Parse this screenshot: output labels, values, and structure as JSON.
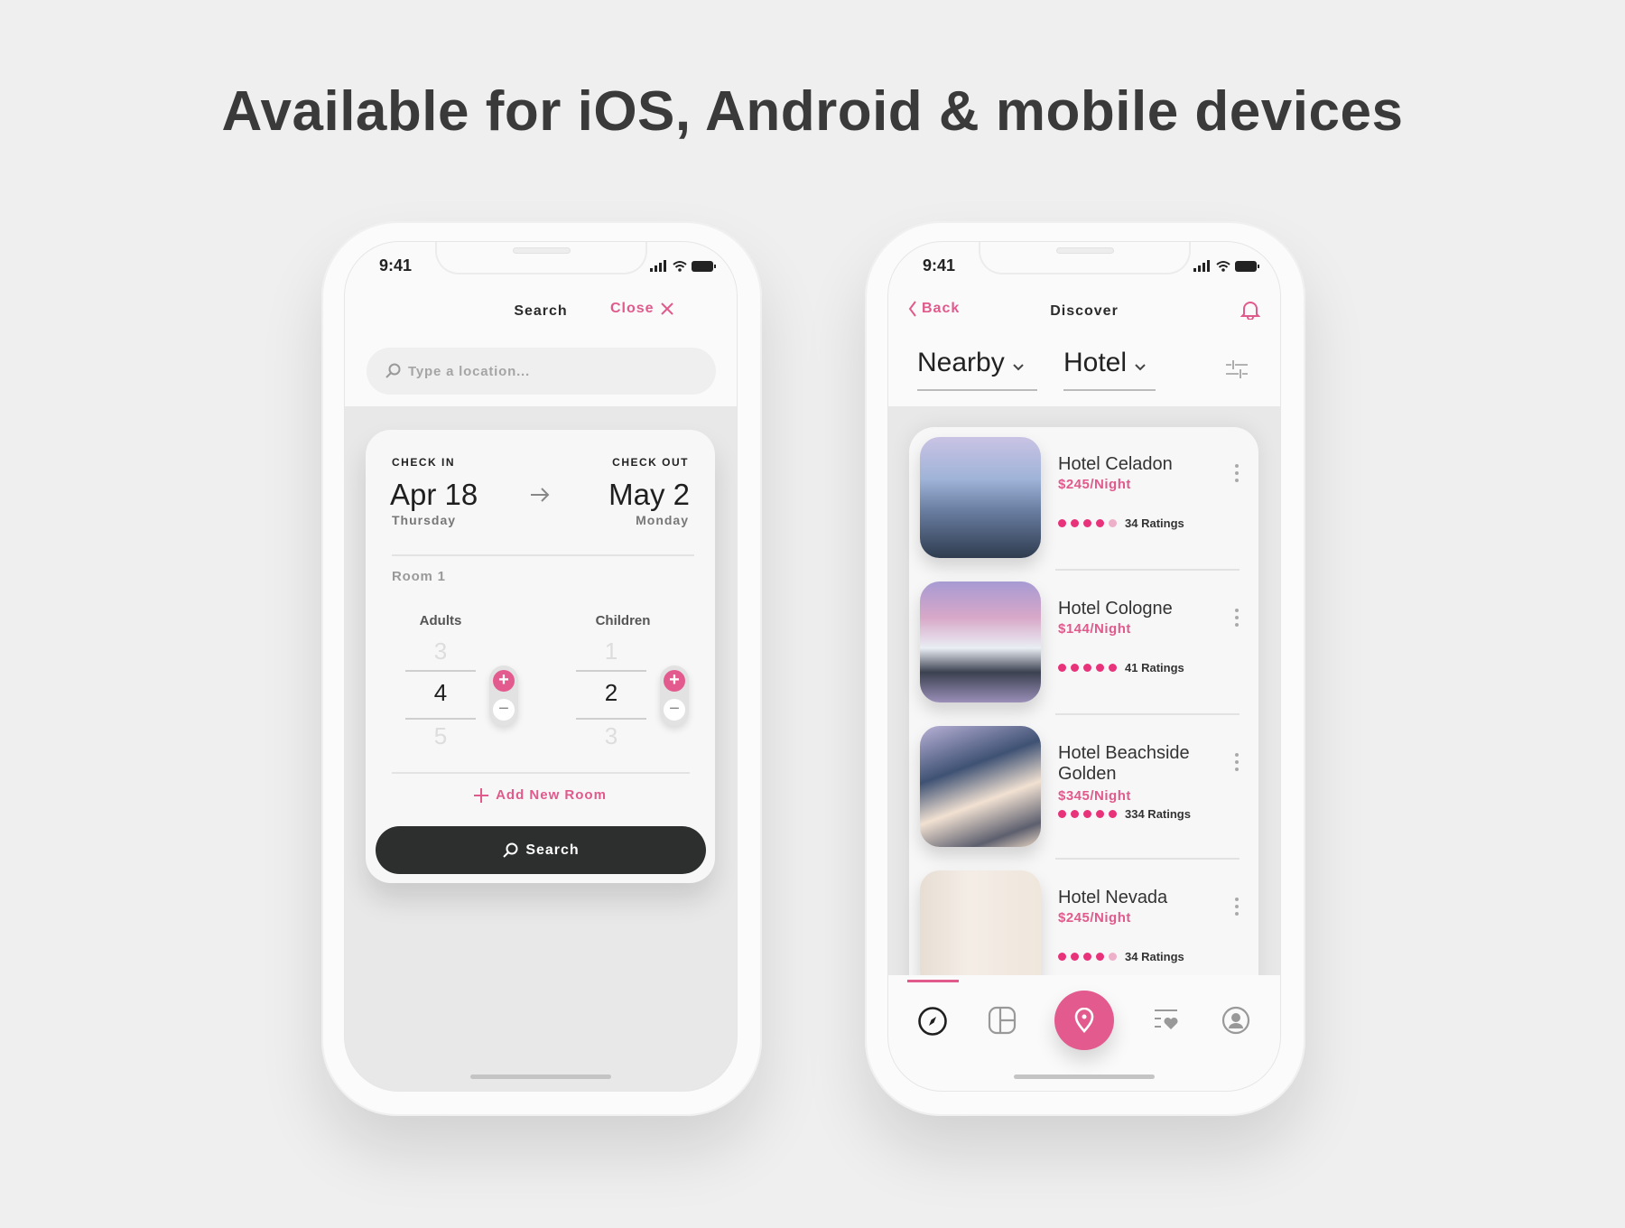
{
  "headline": "Available for iOS, Android & mobile devices",
  "colors": {
    "accent": "#e05a8c",
    "dark_button": "#2d2f2f",
    "background": "#efefef"
  },
  "search_screen": {
    "status_time": "9:41",
    "title": "Search",
    "close_label": "Close",
    "location_placeholder": "Type a location...",
    "check_in": {
      "label": "CHECK IN",
      "date": "Apr 18",
      "day": "Thursday"
    },
    "check_out": {
      "label": "CHECK OUT",
      "date": "May 2",
      "day": "Monday"
    },
    "room_label": "Room 1",
    "adults": {
      "label": "Adults",
      "prev": "3",
      "value": "4",
      "next": "5"
    },
    "children": {
      "label": "Children",
      "prev": "1",
      "value": "2",
      "next": "3"
    },
    "add_room_label": "Add New Room",
    "search_button": "Search"
  },
  "discover_screen": {
    "status_time": "9:41",
    "back_label": "Back",
    "title": "Discover",
    "filter_location": "Nearby",
    "filter_type": "Hotel",
    "hotels": [
      {
        "name": "Hotel Celadon",
        "price": "$245/Night",
        "rating": 4,
        "ratings_label": "34 Ratings"
      },
      {
        "name": "Hotel Cologne",
        "price": "$144/Night",
        "rating": 5,
        "ratings_label": "41 Ratings"
      },
      {
        "name": "Hotel Beachside Golden",
        "price": "$345/Night",
        "rating": 5,
        "ratings_label": "334 Ratings"
      },
      {
        "name": "Hotel Nevada",
        "price": "$245/Night",
        "rating": 4,
        "ratings_label": "34 Ratings"
      }
    ],
    "bottom_nav": [
      "compass-icon",
      "grid-icon",
      "location-pin-icon",
      "favorites-list-icon",
      "profile-icon"
    ],
    "active_nav": "compass-icon"
  }
}
